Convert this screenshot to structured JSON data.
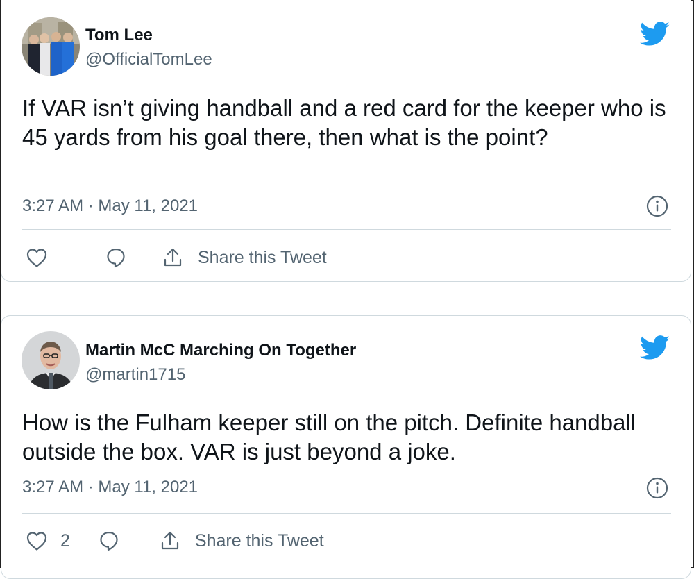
{
  "colors": {
    "twitter_blue": "#1d9bf0",
    "text_primary": "#0f1419",
    "text_secondary": "#536471",
    "border": "#cfd9de"
  },
  "tweets": [
    {
      "name": "Tom Lee",
      "handle": "@OfficialTomLee",
      "text": "If VAR isn’t giving handball and a red card for the keeper who is 45 yards from his goal there, then what is the point?",
      "time": "3:27 AM · May 11, 2021",
      "like_count": "",
      "share_label": "Share this Tweet",
      "icons": [
        "twitter-bird-icon",
        "info-icon",
        "heart-icon",
        "reply-icon",
        "share-icon"
      ]
    },
    {
      "name": "Martin McC Marching On Together",
      "handle": "@martin1715",
      "text": "How is the Fulham keeper still on the pitch. Definite handball outside the box. VAR is just beyond a joke.",
      "time": "3:27 AM · May 11, 2021",
      "like_count": "2",
      "share_label": "Share this Tweet",
      "icons": [
        "twitter-bird-icon",
        "info-icon",
        "heart-icon",
        "reply-icon",
        "share-icon"
      ]
    }
  ]
}
